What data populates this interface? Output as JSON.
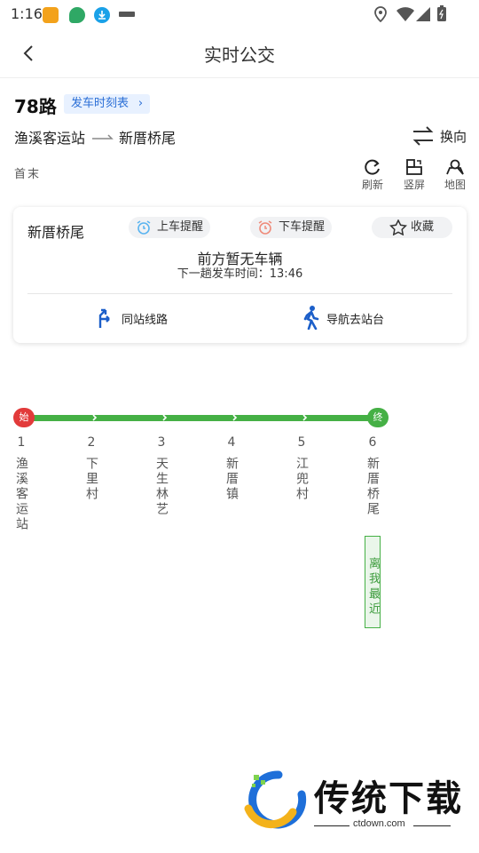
{
  "status_bar": {
    "time": "1:16",
    "icons": [
      "app-orange-icon",
      "app-leaf-icon",
      "download-icon",
      "app-text-icon",
      "location-icon",
      "wifi-icon",
      "signal-icon",
      "battery-icon"
    ]
  },
  "header": {
    "title": "实时公交",
    "back_icon": "chevron-left-icon"
  },
  "route": {
    "number": "78路",
    "timetable_label": "发车时刻表",
    "from": "渔溪客运站",
    "to": "新厝桥尾",
    "switch_label": "换向",
    "first_last": "首末"
  },
  "tools": [
    {
      "label": "刷新",
      "icon": "refresh-icon"
    },
    {
      "label": "竖屏",
      "icon": "portrait-icon"
    },
    {
      "label": "地图",
      "icon": "map-icon"
    }
  ],
  "card": {
    "stop_name": "新厝桥尾",
    "board_remind": "上车提醒",
    "alight_remind": "下车提醒",
    "favorite": "收藏",
    "status": "前方暂无车辆",
    "next_departure": "下一趟发车时间：13:46",
    "same_station_lines": "同站线路",
    "navigate": "导航去站台"
  },
  "line": {
    "start_badge": "始",
    "end_badge": "终",
    "stations": [
      {
        "no": "1",
        "name": "渔溪客运站"
      },
      {
        "no": "2",
        "name": "下里村"
      },
      {
        "no": "3",
        "name": "天生林艺"
      },
      {
        "no": "4",
        "name": "新厝镇"
      },
      {
        "no": "5",
        "name": "江兜村"
      },
      {
        "no": "6",
        "name": "新厝桥尾"
      }
    ],
    "nearest_label": "离我最近"
  },
  "watermark": {
    "text": "传统下载",
    "url": "ctdown.com"
  },
  "colors": {
    "line_green": "#45b045",
    "start_red": "#e23a3a",
    "accent_blue": "#2b6fd6"
  }
}
